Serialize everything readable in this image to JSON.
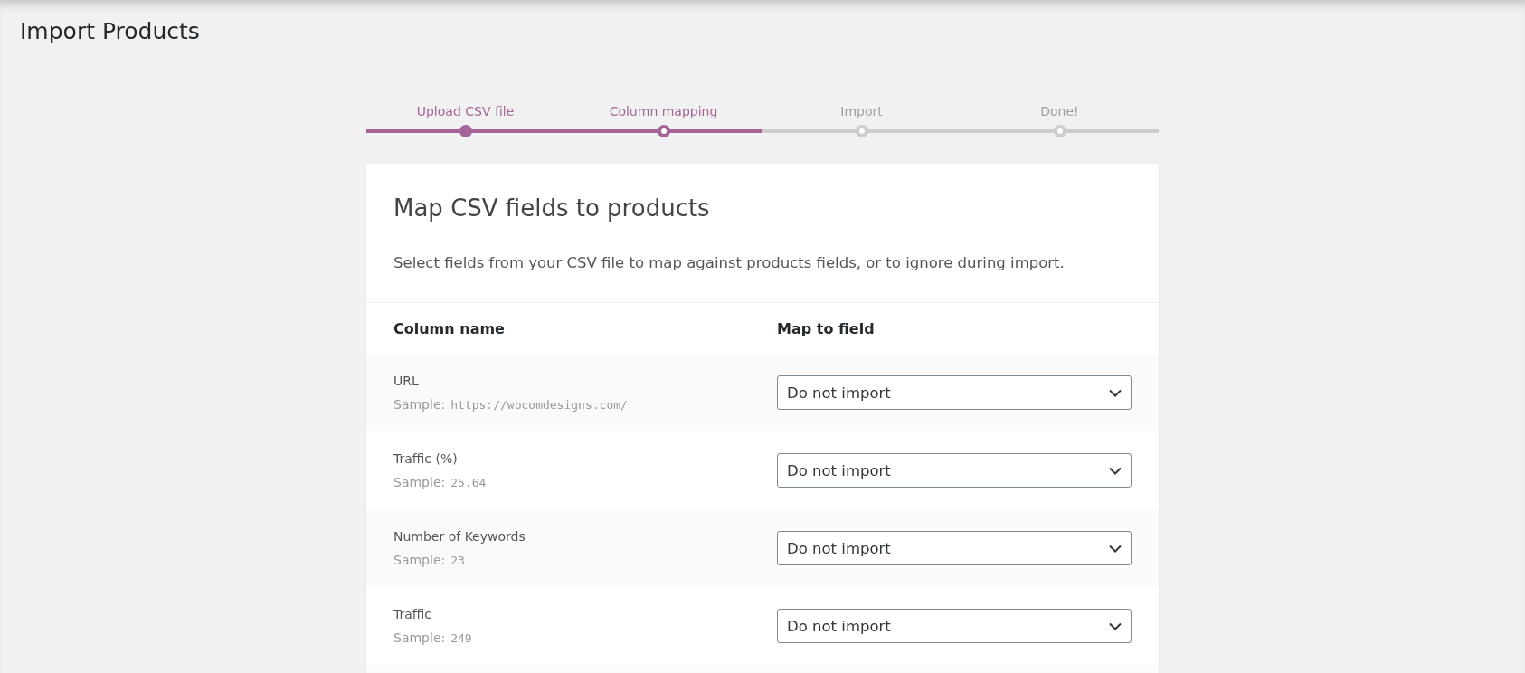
{
  "page_title": "Import Products",
  "steps": [
    {
      "label": "Upload CSV file",
      "kind": "done"
    },
    {
      "label": "Column mapping",
      "kind": "active"
    },
    {
      "label": "Import",
      "kind": "pending"
    },
    {
      "label": "Done!",
      "kind": "pending"
    }
  ],
  "card": {
    "title": "Map CSV fields to products",
    "description": "Select fields from your CSV file to map against products fields, or to ignore during import."
  },
  "table": {
    "columns": [
      "Column name",
      "Map to field"
    ],
    "rows": [
      {
        "name": "URL",
        "sample_label": "Sample:",
        "sample": "https://wbcomdesigns.com/",
        "field": "Do not import"
      },
      {
        "name": "Traffic (%)",
        "sample_label": "Sample:",
        "sample": "25.64",
        "field": "Do not import"
      },
      {
        "name": "Number of Keywords",
        "sample_label": "Sample:",
        "sample": "23",
        "field": "Do not import"
      },
      {
        "name": "Traffic",
        "sample_label": "Sample:",
        "sample": "249",
        "field": "Do not import"
      }
    ]
  }
}
